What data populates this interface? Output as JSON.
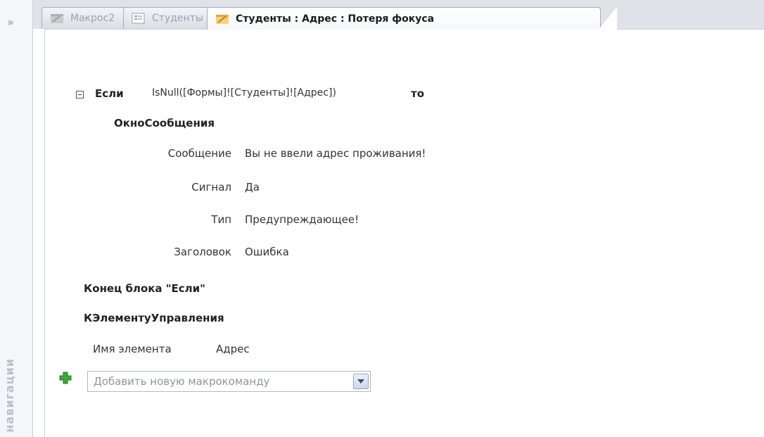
{
  "nav": {
    "collapse_glyph": "»",
    "vertical_label": "навигации"
  },
  "tabs": [
    {
      "label": "Макрос2",
      "icon": "macro-icon",
      "active": false
    },
    {
      "label": "Студенты",
      "icon": "form-icon",
      "active": false
    },
    {
      "label": "Студенты : Адрес : Потеря фокуса",
      "icon": "macro-icon",
      "active": true
    }
  ],
  "macro": {
    "if_block": {
      "keyword_if": "Если",
      "condition": "IsNull([Формы]![Студенты]![Адрес])",
      "keyword_then": "то",
      "action": {
        "name": "ОкноСообщения",
        "args": [
          {
            "label": "Сообщение",
            "value": "Вы не ввели адрес проживания!"
          },
          {
            "label": "Сигнал",
            "value": "Да"
          },
          {
            "label": "Тип",
            "value": "Предупреждающее!"
          },
          {
            "label": "Заголовок",
            "value": "Ошибка"
          }
        ]
      },
      "end_label": "Конец блока \"Если\""
    },
    "goto_action": {
      "name": "КЭлементуУправления",
      "arg_label": "Имя элемента",
      "arg_value": "Адрес"
    },
    "add_action": {
      "placeholder": "Добавить новую макрокоманду"
    }
  },
  "colors": {
    "macro_icon": "#e8a53a",
    "plus_icon": "#3aa935",
    "tab_bg": "#dfe3e8"
  }
}
